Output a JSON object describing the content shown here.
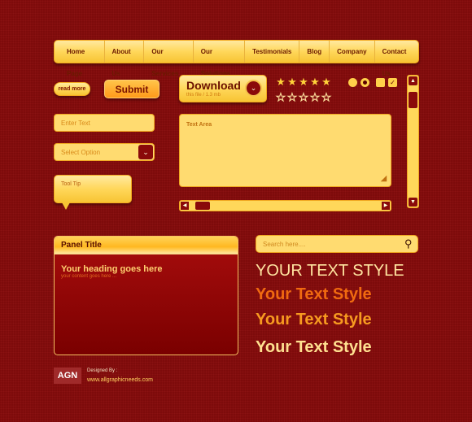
{
  "nav": {
    "items": [
      "Home Page",
      "About Us",
      "Our Services",
      "Our Solutions",
      "Testimonials",
      "Blog",
      "Company",
      "Contact Us"
    ]
  },
  "buttons": {
    "read_more": "read more",
    "submit": "Submit",
    "download": "Download",
    "download_sub": "this file / 1.3 mb"
  },
  "rating": {
    "filled": 5,
    "empty": 5
  },
  "inputs": {
    "text_placeholder": "Enter Text",
    "select_value": "Select Option",
    "textarea_label": "Text Area",
    "search_placeholder": "Search here...."
  },
  "tooltip": {
    "label": "Tool Tip"
  },
  "panel": {
    "title": "Panel Title",
    "heading": "Your heading goes here",
    "content": "your content goes here ..."
  },
  "text_styles": [
    "YOUR TEXT STYLE",
    "Your Text Style",
    "Your Text Style",
    "Your Text Style"
  ],
  "footer": {
    "logo": "AGN",
    "designed_by": "Designed By :",
    "url": "www.allgraphicneeds.com"
  },
  "colors": {
    "background": "#7d0b0b",
    "gold": "#ffd75a",
    "accent": "#f08a10",
    "dark_red": "#8a0000"
  }
}
